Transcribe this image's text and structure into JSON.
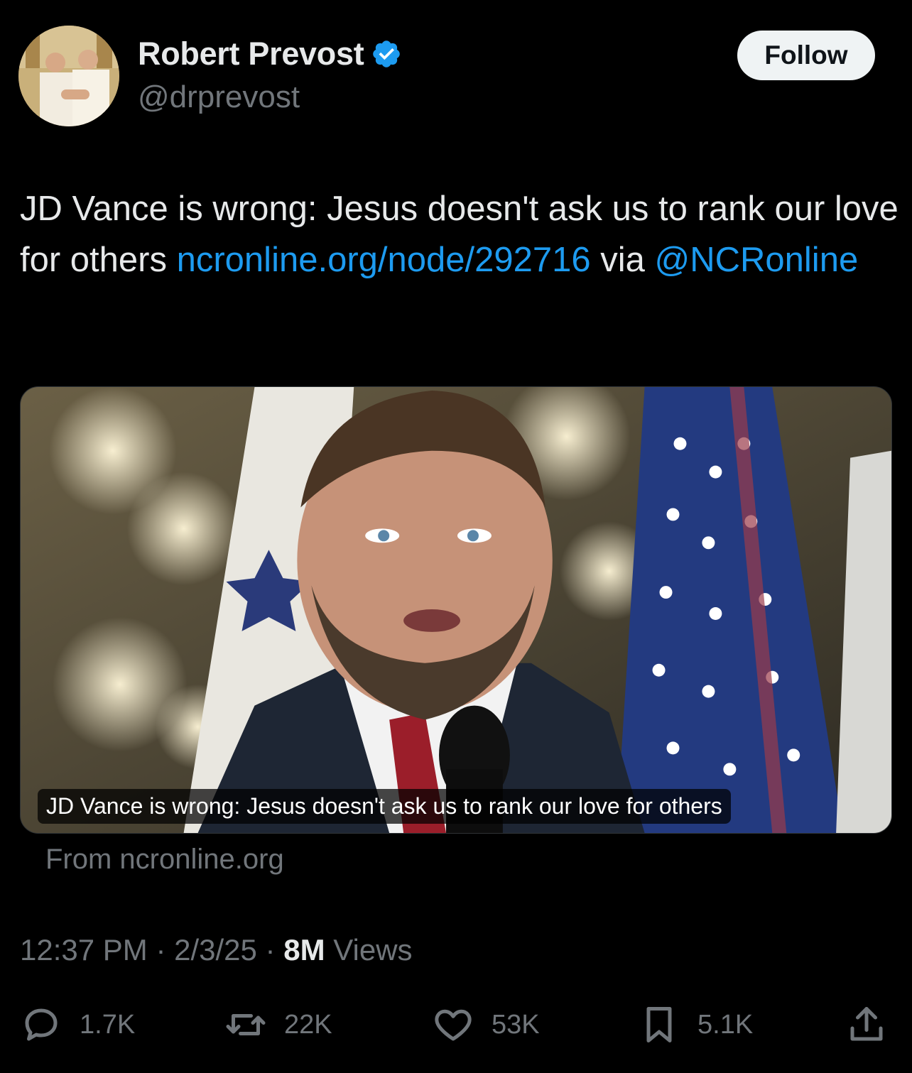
{
  "author": {
    "display_name": "Robert Prevost",
    "handle": "@drprevost",
    "verified_icon": "verified-badge-icon",
    "verified_color": "#1d9bf0"
  },
  "follow_label": "Follow",
  "tweet": {
    "text_part1": "JD Vance is wrong: Jesus doesn't ask us to rank our love for others ",
    "link": "ncronline.org/node/292716",
    "text_part2": " via ",
    "mention": "@NCRonline"
  },
  "card": {
    "title": "JD Vance is wrong: Jesus doesn't ask us to rank our love for others",
    "source": "From ncronline.org"
  },
  "meta": {
    "time": "12:37 PM",
    "separator": " · ",
    "date": "2/3/25",
    "views_count": "8M",
    "views_label": " Views"
  },
  "actions": {
    "replies": "1.7K",
    "reposts": "22K",
    "likes": "53K",
    "bookmarks": "5.1K"
  },
  "colors": {
    "background": "#000000",
    "text": "#e7e9ea",
    "muted": "#71767b",
    "link": "#1d9bf0"
  }
}
